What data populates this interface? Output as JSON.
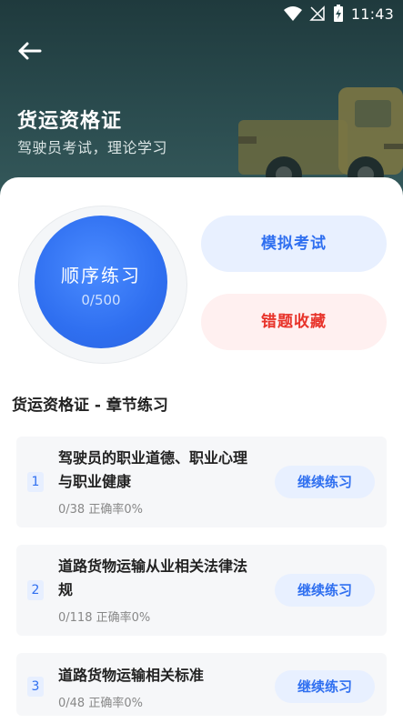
{
  "status_bar": {
    "time": "11:43"
  },
  "header": {
    "title": "货运资格证",
    "subtitle": "驾驶员考试，理论学习"
  },
  "practice": {
    "sequential_label": "顺序练习",
    "sequential_progress": "0/500",
    "mock_exam_label": "模拟考试",
    "wrong_collect_label": "错题收藏"
  },
  "section": {
    "title": "货运资格证 - 章节练习"
  },
  "chapters": [
    {
      "num": "1",
      "title_line1": "驾驶员的职业道德、职业心理",
      "title_line2": "与职业健康",
      "meta": "0/38 正确率0%",
      "button": "继续练习"
    },
    {
      "num": "2",
      "title_line1": "道路货物运输从业相关法律法",
      "title_line2": "规",
      "meta": "0/118 正确率0%",
      "button": "继续练习"
    },
    {
      "num": "3",
      "title_line1": "道路货物运输相关标准",
      "title_line2": "",
      "meta": "0/48 正确率0%",
      "button": "继续练习"
    }
  ],
  "colors": {
    "accent_blue": "#2f6ff0",
    "accent_red": "#e8332a",
    "header_bg": "#2a4b4e"
  }
}
